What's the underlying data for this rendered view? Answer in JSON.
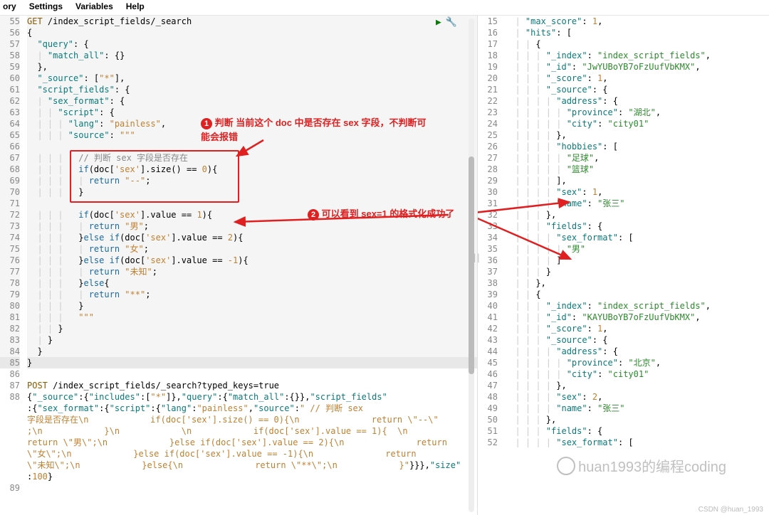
{
  "menubar": [
    "ory",
    "Settings",
    "Variables",
    "Help"
  ],
  "run": {
    "play": "▶",
    "wrench": "🔧"
  },
  "drag": "||",
  "watermark": "huan1993的编程coding",
  "credit": "CSDN @huan_1993",
  "annotations": {
    "a1": "判断 当前这个 doc 中是否存在 sex 字段，不判断可能会报错",
    "a2": "可以看到 sex=1 的格式化成功了"
  },
  "left": {
    "start": 55,
    "hl_start": 55,
    "hl_end": 85,
    "hl_focus": 85,
    "lines": [
      "<span class='tok-method'>GET</span> /index_script_fields/_search",
      "{",
      "  <span class='tok-key'>\"query\"</span>: {",
      "<span class='tok-guide'>  | </span><span class='tok-key'>\"match_all\"</span>: {}",
      "  },",
      "  <span class='tok-key'>\"_source\"</span>: [<span class='tok-str'>\"*\"</span>],",
      "  <span class='tok-key'>\"script_fields\"</span>: {",
      "<span class='tok-guide'>  | </span><span class='tok-key'>\"sex_format\"</span>: {",
      "<span class='tok-guide'>  | | </span><span class='tok-key'>\"script\"</span>: {",
      "<span class='tok-guide'>  | | | </span><span class='tok-key'>\"lang\"</span>: <span class='tok-str'>\"painless\"</span>,",
      "<span class='tok-guide'>  | | | </span><span class='tok-key'>\"source\"</span>: <span class='tok-str'>\"\"\"</span>",
      "",
      "<span class='tok-guide'>  | | |   </span><span class='tok-comment'>// 判断 sex 字段是否存在</span>",
      "<span class='tok-guide'>  | | |   </span><span class='tok-kw'>if</span>(doc[<span class='tok-str'>'sex'</span>].size() == <span class='tok-num'>0</span>){",
      "<span class='tok-guide'>  | | |   | </span><span class='tok-kw'>return</span> <span class='tok-str'>\"--\"</span>;",
      "<span class='tok-guide'>  | | |   </span>}",
      "",
      "<span class='tok-guide'>  | | |   </span><span class='tok-kw'>if</span>(doc[<span class='tok-str'>'sex'</span>].value == <span class='tok-num'>1</span>){",
      "<span class='tok-guide'>  | | |   | </span><span class='tok-kw'>return</span> <span class='tok-str'>\"男\"</span>;",
      "<span class='tok-guide'>  | | |   </span>}<span class='tok-kw'>else if</span>(doc[<span class='tok-str'>'sex'</span>].value == <span class='tok-num'>2</span>){",
      "<span class='tok-guide'>  | | |   | </span><span class='tok-kw'>return</span> <span class='tok-str'>\"女\"</span>;",
      "<span class='tok-guide'>  | | |   </span>}<span class='tok-kw'>else if</span>(doc[<span class='tok-str'>'sex'</span>].value == <span class='tok-num'>-1</span>){",
      "<span class='tok-guide'>  | | |   | </span><span class='tok-kw'>return</span> <span class='tok-str'>\"未知\"</span>;",
      "<span class='tok-guide'>  | | |   </span>}<span class='tok-kw'>else</span>{",
      "<span class='tok-guide'>  | | |   | </span><span class='tok-kw'>return</span> <span class='tok-str'>\"**\"</span>;",
      "<span class='tok-guide'>  | | |   </span>}",
      "<span class='tok-guide'>  | | |   </span><span class='tok-str'>\"\"\"</span>",
      "<span class='tok-guide'>  | | </span>}",
      "<span class='tok-guide'>  | </span>}",
      "  }",
      "}",
      "",
      "<span class='tok-method'>POST</span> /index_script_fields/_search?typed_keys=true",
      "{<span class='tok-key'>\"_source\"</span>:{<span class='tok-key'>\"includes\"</span>:[<span class='tok-str'>\"*\"</span>]},<span class='tok-key'>\"query\"</span>:{<span class='tok-key'>\"match_all\"</span>:{}},<span class='tok-key'>\"script_fields\"</span>",
      ":{<span class='tok-key'>\"sex_format\"</span>:{<span class='tok-key'>\"script\"</span>:{<span class='tok-key'>\"lang\"</span>:<span class='tok-str'>\"painless\"</span>,<span class='tok-key'>\"source\"</span>:<span class='tok-str'>\" // 判断 sex</span>",
      "<span class='tok-str'>字段是否存在\\n            if(doc['sex'].size() == 0){\\n              return \\\"--\\\"</span>",
      "<span class='tok-str'>;\\n            }\\n            \\n            if(doc['sex'].value == 1){  \\n</span>",
      "<span class='tok-str'>return \\\"男\\\";\\n            }else if(doc['sex'].value == 2){\\n              return</span>",
      "<span class='tok-str'>\\\"女\\\";\\n            }else if(doc['sex'].value == -1){\\n              return</span>",
      "<span class='tok-str'>\\\"未知\\\";\\n            }else{\\n              return \\\"**\\\";\\n            }\"</span>}}},<span class='tok-key'>\"size\"</span>",
      ":<span class='tok-num'>100</span>}",
      ""
    ]
  },
  "right": {
    "start": 15,
    "lines": [
      "<span class='tok-guide'>  | </span><span class='tok-key'>\"max_score\"</span>: <span class='tok-num'>1</span>,",
      "<span class='tok-guide'>  | </span><span class='tok-key'>\"hits\"</span>: [",
      "<span class='tok-guide'>  | | </span>{",
      "<span class='tok-guide'>  | | | </span><span class='tok-key'>\"_index\"</span>: <span class='tok-val'>\"index_script_fields\"</span>,",
      "<span class='tok-guide'>  | | | </span><span class='tok-key'>\"_id\"</span>: <span class='tok-val'>\"JwYUBoYB7oFzUufVbKMX\"</span>,",
      "<span class='tok-guide'>  | | | </span><span class='tok-key'>\"_score\"</span>: <span class='tok-num'>1</span>,",
      "<span class='tok-guide'>  | | | </span><span class='tok-key'>\"_source\"</span>: {",
      "<span class='tok-guide'>  | | | | </span><span class='tok-key'>\"address\"</span>: {",
      "<span class='tok-guide'>  | | | | | </span><span class='tok-key'>\"province\"</span>: <span class='tok-val'>\"湖北\"</span>,",
      "<span class='tok-guide'>  | | | | | </span><span class='tok-key'>\"city\"</span>: <span class='tok-val'>\"city01\"</span>",
      "<span class='tok-guide'>  | | | | </span>},",
      "<span class='tok-guide'>  | | | | </span><span class='tok-key'>\"hobbies\"</span>: [",
      "<span class='tok-guide'>  | | | | | </span><span class='tok-val'>\"足球\"</span>,",
      "<span class='tok-guide'>  | | | | | </span><span class='tok-val'>\"篮球\"</span>",
      "<span class='tok-guide'>  | | | | </span>],",
      "<span class='tok-guide'>  | | | | </span><span class='tok-key'>\"sex\"</span>: <span class='tok-num'>1</span>,",
      "<span class='tok-guide'>  | | | | </span><span class='tok-key'>\"name\"</span>: <span class='tok-val'>\"张三\"</span>",
      "<span class='tok-guide'>  | | | </span>},",
      "<span class='tok-guide'>  | | | </span><span class='tok-key'>\"fields\"</span>: {",
      "<span class='tok-guide'>  | | | | </span><span class='tok-key'>\"sex_format\"</span>: [",
      "<span class='tok-guide'>  | | | | | </span><span class='tok-val'>\"男\"</span>",
      "<span class='tok-guide'>  | | | | </span>]",
      "<span class='tok-guide'>  | | | </span>}",
      "<span class='tok-guide'>  | | </span>},",
      "<span class='tok-guide'>  | | </span>{",
      "<span class='tok-guide'>  | | | </span><span class='tok-key'>\"_index\"</span>: <span class='tok-val'>\"index_script_fields\"</span>,",
      "<span class='tok-guide'>  | | | </span><span class='tok-key'>\"_id\"</span>: <span class='tok-val'>\"KAYUBoYB7oFzUufVbKMX\"</span>,",
      "<span class='tok-guide'>  | | | </span><span class='tok-key'>\"_score\"</span>: <span class='tok-num'>1</span>,",
      "<span class='tok-guide'>  | | | </span><span class='tok-key'>\"_source\"</span>: {",
      "<span class='tok-guide'>  | | | | </span><span class='tok-key'>\"address\"</span>: {",
      "<span class='tok-guide'>  | | | | | </span><span class='tok-key'>\"province\"</span>: <span class='tok-val'>\"北京\"</span>,",
      "<span class='tok-guide'>  | | | | | </span><span class='tok-key'>\"city\"</span>: <span class='tok-val'>\"city01\"</span>",
      "<span class='tok-guide'>  | | | | </span>},",
      "<span class='tok-guide'>  | | | | </span><span class='tok-key'>\"sex\"</span>: <span class='tok-num'>2</span>,",
      "<span class='tok-guide'>  | | | | </span><span class='tok-key'>\"name\"</span>: <span class='tok-val'>\"张三\"</span>",
      "<span class='tok-guide'>  | | | </span>},",
      "<span class='tok-guide'>  | | | </span><span class='tok-key'>\"fields\"</span>: {",
      "<span class='tok-guide'>  | | | | </span><span class='tok-key'>\"sex_format\"</span>: ["
    ]
  }
}
